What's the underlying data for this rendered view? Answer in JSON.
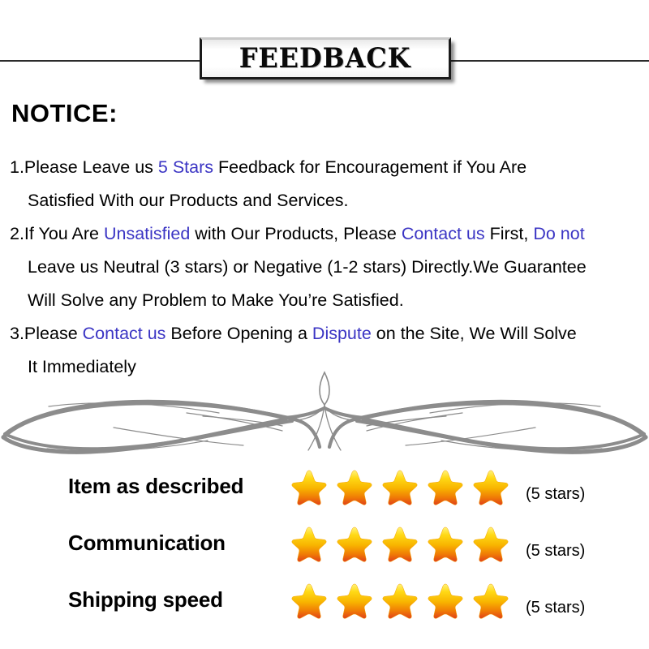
{
  "banner": {
    "title": "FEEDBACK"
  },
  "notice": {
    "heading": "NOTICE:",
    "lines": [
      [
        {
          "text": "1.Please Leave us  ",
          "highlight": false
        },
        {
          "text": "5 Stars",
          "highlight": true
        },
        {
          "text": "  Feedback for  Encouragement  if You Are",
          "highlight": false
        }
      ],
      [
        {
          "text": "Satisfied With our Products and Services.",
          "highlight": false
        }
      ],
      [
        {
          "text": "2.If You Are ",
          "highlight": false
        },
        {
          "text": "Unsatisfied",
          "highlight": true
        },
        {
          "text": " with Our Products, Please ",
          "highlight": false
        },
        {
          "text": "Contact us",
          "highlight": true
        },
        {
          "text": " First, ",
          "highlight": false
        },
        {
          "text": "Do not",
          "highlight": true
        }
      ],
      [
        {
          "text": "Leave us Neutral (3 stars) or Negative (1-2 stars) Directly.We Guarantee",
          "highlight": false
        }
      ],
      [
        {
          "text": "Will Solve any Problem to Make You’re  Satisfied.",
          "highlight": false
        }
      ],
      [
        {
          "text": "3.Please ",
          "highlight": false
        },
        {
          "text": "Contact us",
          "highlight": true
        },
        {
          "text": " Before Opening a ",
          "highlight": false
        },
        {
          "text": "Dispute",
          "highlight": true
        },
        {
          "text": " on the Site, We Will Solve",
          "highlight": false
        }
      ],
      [
        {
          "text": "It Immediately",
          "highlight": false
        }
      ]
    ],
    "indented_lines": [
      1,
      3,
      4,
      6
    ]
  },
  "divider": {
    "icon": "ornamental-flourish-divider",
    "color": "#8c8c8c"
  },
  "ratings": {
    "rows": [
      {
        "label": "Item as described",
        "stars": 5,
        "count_text": "(5 stars)"
      },
      {
        "label": "Communication",
        "stars": 5,
        "count_text": "(5 stars)"
      },
      {
        "label": "Shipping speed",
        "stars": 5,
        "count_text": "(5 stars)"
      }
    ],
    "star_colors": {
      "top": "#ffe23a",
      "mid": "#f5a800",
      "bottom": "#e8491a"
    }
  },
  "colors": {
    "highlight_blue": "#3b35c4",
    "text_black": "#000000",
    "background": "#ffffff"
  }
}
